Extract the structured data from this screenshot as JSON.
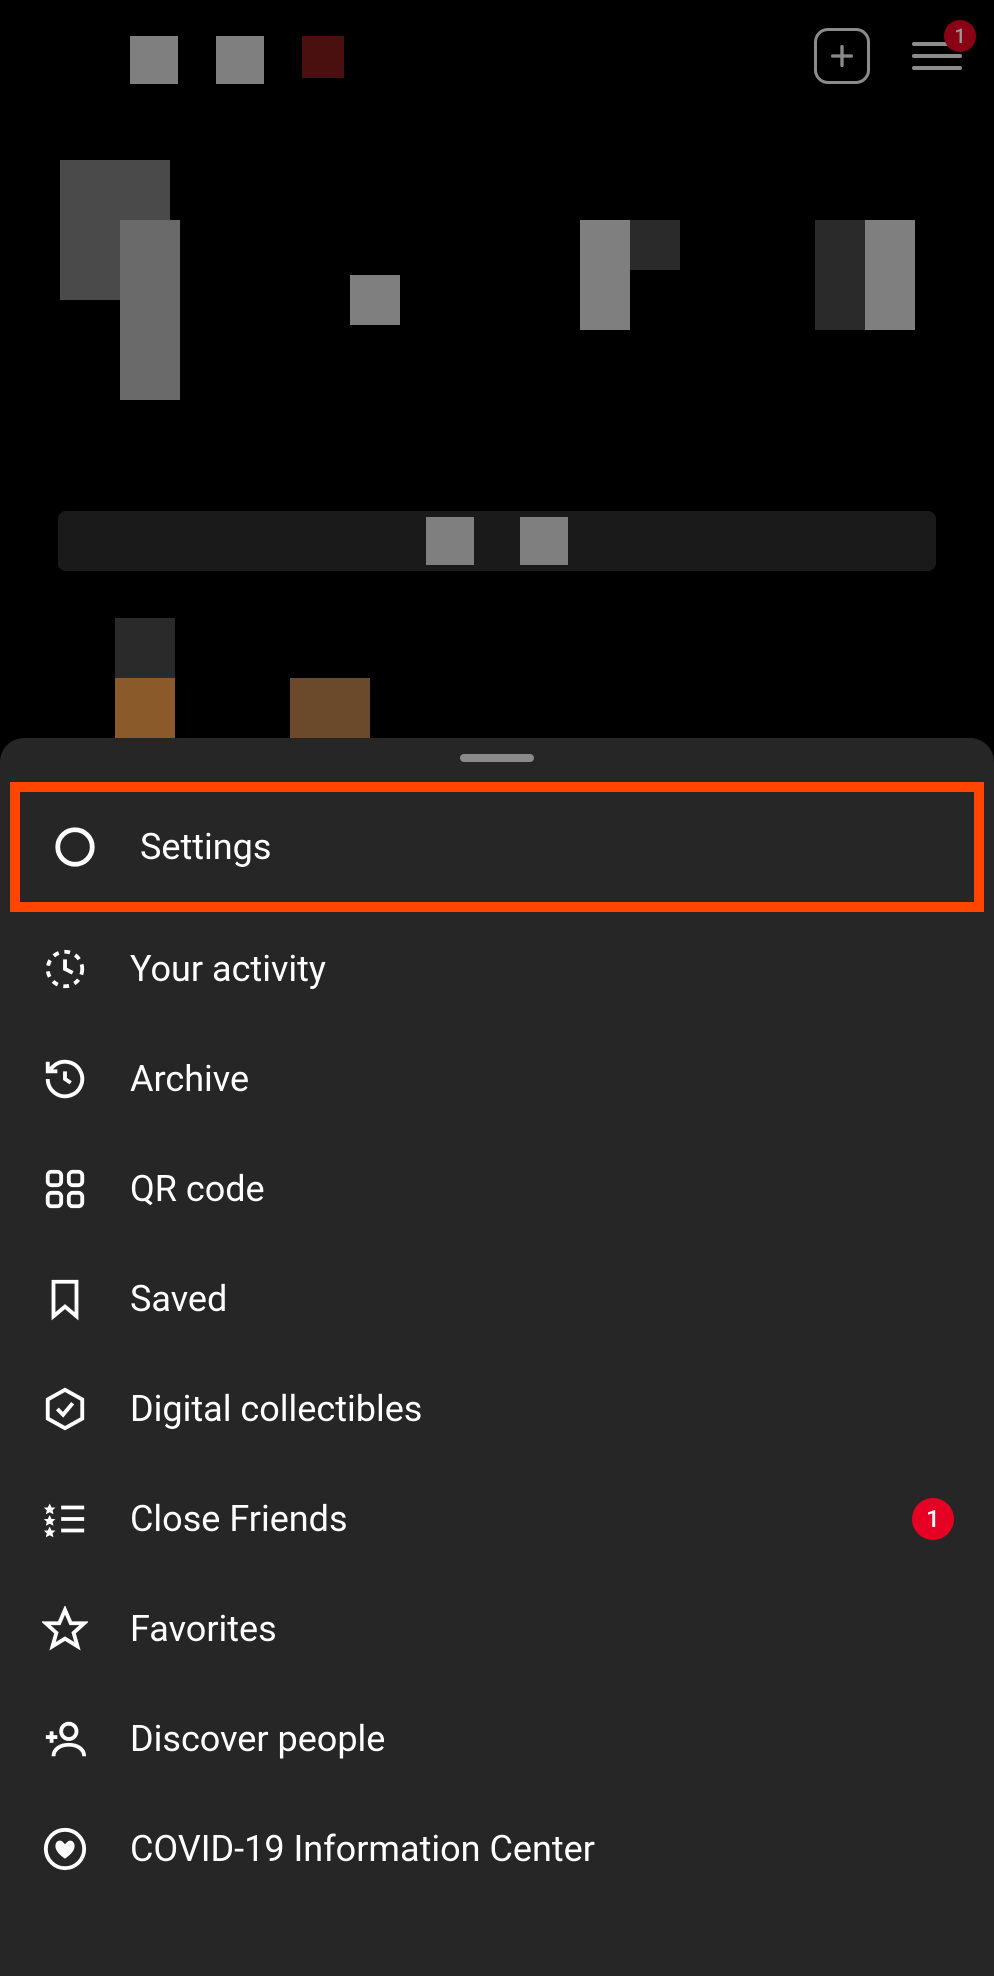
{
  "header": {
    "notification_count": "1"
  },
  "menu": {
    "items": [
      {
        "label": "Settings",
        "highlighted": true
      },
      {
        "label": "Your activity"
      },
      {
        "label": "Archive"
      },
      {
        "label": "QR code"
      },
      {
        "label": "Saved"
      },
      {
        "label": "Digital collectibles"
      },
      {
        "label": "Close Friends",
        "badge": "1"
      },
      {
        "label": "Favorites"
      },
      {
        "label": "Discover people"
      },
      {
        "label": "COVID-19 Information Center"
      }
    ]
  }
}
